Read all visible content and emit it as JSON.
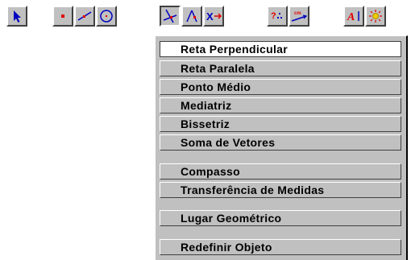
{
  "toolbar": {
    "buttons": [
      {
        "icon": "arrow-pointer-icon",
        "pressed": false
      },
      {
        "icon": "point-icon",
        "pressed": false
      },
      {
        "icon": "line-icon",
        "pressed": false
      },
      {
        "icon": "circle-icon",
        "pressed": false
      },
      {
        "icon": "perpendicular-icon",
        "pressed": true
      },
      {
        "icon": "intersection-icon",
        "pressed": false
      },
      {
        "icon": "transform-icon",
        "pressed": false
      },
      {
        "icon": "question-dots-icon",
        "pressed": false
      },
      {
        "icon": "measure-cm-icon",
        "pressed": false
      },
      {
        "icon": "text-icon",
        "pressed": false,
        "label": "A"
      },
      {
        "icon": "display-sun-icon",
        "pressed": false
      }
    ]
  },
  "menu": {
    "items": [
      {
        "label": "Reta Perpendicular",
        "selected": true
      },
      {
        "label": "Reta Paralela",
        "selected": false
      },
      {
        "label": "Ponto Médio",
        "selected": false
      },
      {
        "label": "Mediatriz",
        "selected": false
      },
      {
        "label": "Bissetriz",
        "selected": false
      },
      {
        "label": "Soma de Vetores",
        "selected": false
      },
      {
        "label": "Compasso",
        "selected": false
      },
      {
        "label": "Transferência de Medidas",
        "selected": false
      },
      {
        "label": "Lugar Geométrico",
        "selected": false
      },
      {
        "label": "Redefinir Objeto",
        "selected": false
      }
    ]
  },
  "colors": {
    "face": "#c0c0c0",
    "icon_blue": "#0000c0",
    "icon_red": "#e00000",
    "highlight": "#ffffff"
  }
}
